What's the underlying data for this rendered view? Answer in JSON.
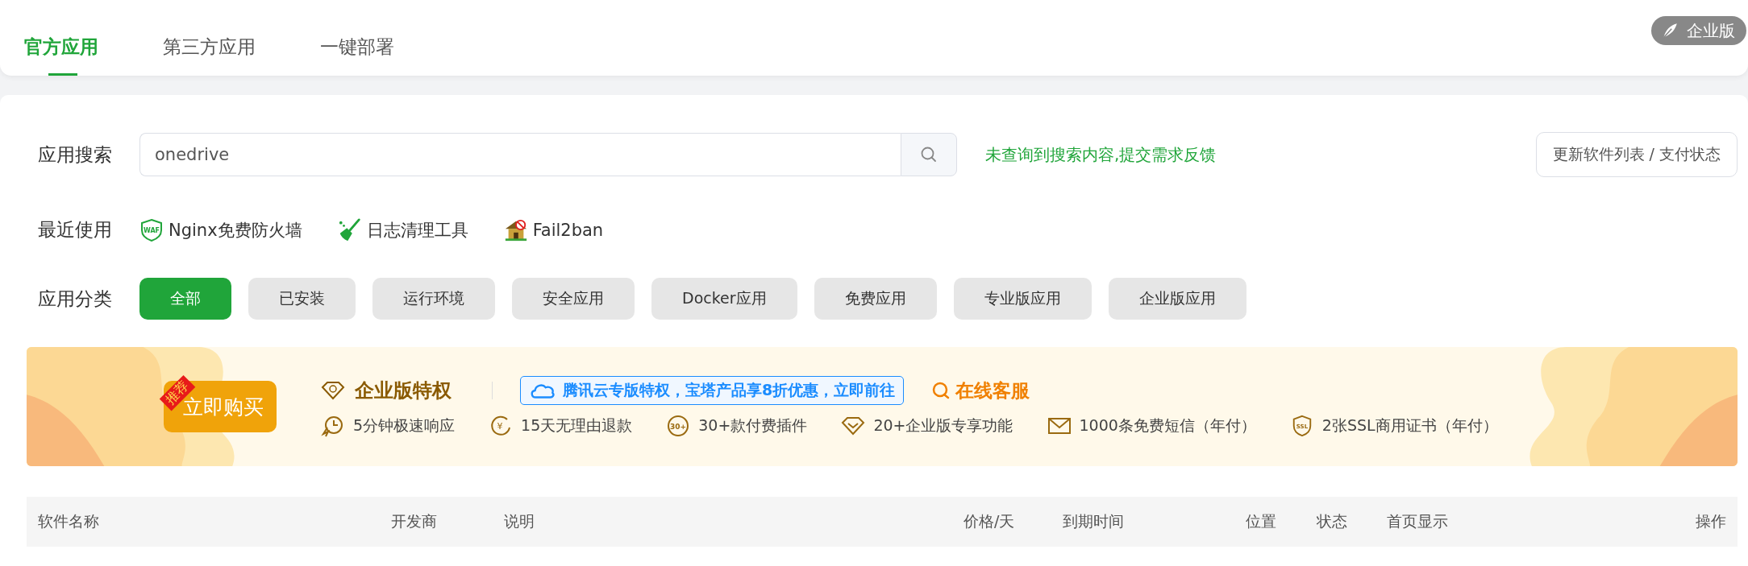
{
  "tabs": [
    {
      "label": "官方应用",
      "selected": true
    },
    {
      "label": "第三方应用",
      "selected": false
    },
    {
      "label": "一键部署",
      "selected": false
    }
  ],
  "edition_badge": "企业版",
  "search": {
    "label": "应用搜索",
    "value": "onedrive",
    "feedback_link": "未查询到搜索内容,提交需求反馈",
    "update_button": "更新软件列表 / 支付状态"
  },
  "recent": {
    "label": "最近使用",
    "items": [
      {
        "kind": "shield",
        "icon_text": "WAF",
        "name": "Nginx免费防火墙"
      },
      {
        "kind": "broom",
        "name": "日志清理工具"
      },
      {
        "kind": "house",
        "name": "Fail2ban"
      }
    ]
  },
  "categories": {
    "label": "应用分类",
    "items": [
      {
        "label": "全部",
        "selected": true
      },
      {
        "label": "已安装",
        "selected": false
      },
      {
        "label": "运行环境",
        "selected": false
      },
      {
        "label": "安全应用",
        "selected": false
      },
      {
        "label": "Docker应用",
        "selected": false
      },
      {
        "label": "免费应用",
        "selected": false
      },
      {
        "label": "专业版应用",
        "selected": false
      },
      {
        "label": "企业版应用",
        "selected": false
      }
    ]
  },
  "banner": {
    "ribbon": "推荐",
    "buy_button": "立即购买",
    "title": "企业版特权",
    "promo": "腾讯云专版特权，宝塔产品享8折优惠，立即前往",
    "service": "在线客服",
    "features": [
      {
        "kind": "clock",
        "label": "5分钟极速响应"
      },
      {
        "kind": "yen",
        "icon_text": "¥",
        "label": "15天无理由退款"
      },
      {
        "kind": "ring",
        "icon_text": "30+",
        "label": "30+款付费插件"
      },
      {
        "kind": "diamond",
        "label": "20+企业版专享功能"
      },
      {
        "kind": "mail",
        "label": "1000条免费短信（年付）"
      },
      {
        "kind": "shield",
        "icon_text": "SSL",
        "label": "2张SSL商用证书（年付）"
      }
    ]
  },
  "table": {
    "columns": [
      "软件名称",
      "开发商",
      "说明",
      "价格/天",
      "到期时间",
      "位置",
      "状态",
      "首页显示",
      "操作"
    ]
  }
}
